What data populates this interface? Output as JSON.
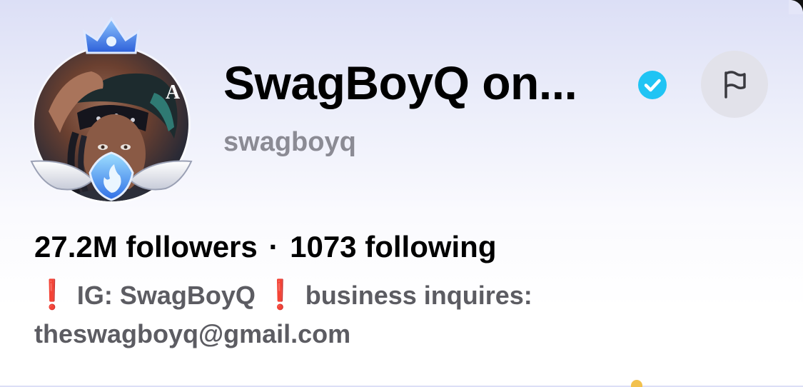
{
  "profile": {
    "display_name": "SwagBoyQ on...",
    "username": "swagboyq",
    "verified": true
  },
  "stats": {
    "followers": "27.2M followers",
    "separator": "·",
    "following": "1073 following"
  },
  "bio": {
    "line1_marker": "❗",
    "ig_text": "IG: SwagBoyQ",
    "line2_marker": "❗",
    "business_text": "business inquires:",
    "email": "theswagboyq@gmail.com"
  },
  "icons": {
    "verified": "verified-badge-icon",
    "report": "flag-icon",
    "crown": "crown-icon",
    "flame": "flame-icon"
  },
  "colors": {
    "verified_badge": "#20c4f4",
    "bio_marker": "#e01b1b",
    "username": "#8b8b94",
    "bio_text": "#5c5c62",
    "flag_button_bg": "#e2e2ea"
  }
}
